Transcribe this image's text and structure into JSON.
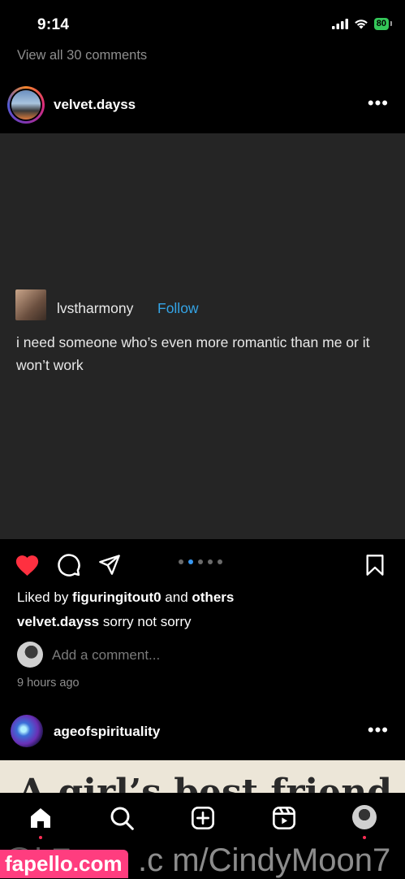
{
  "status_bar": {
    "time": "9:14",
    "battery": "80"
  },
  "previous_post": {
    "view_comments": "View all 30 comments"
  },
  "post1": {
    "username": "velvet.dayss",
    "quote": {
      "username": "lvstharmony",
      "follow": "Follow",
      "text": "i need someone who’s even more romantic than me or it won’t work"
    },
    "liked_by_prefix": "Liked by ",
    "liked_by_user": "figuringitout0",
    "liked_by_and": " and ",
    "liked_by_others": "others",
    "caption_user": "velvet.dayss",
    "caption_text": " sorry not sorry",
    "add_comment_placeholder": "Add a comment...",
    "time_ago": "9 hours ago"
  },
  "post2": {
    "username": "ageofspirituality",
    "image_text": "A girl’s best friend isn’t"
  },
  "watermark": {
    "site": "fapello.com",
    "text": ".c m/CindyMoon7",
    "left_text": "@i F"
  },
  "colors": {
    "accent_blue": "#3897f0",
    "like_red": "#ff3040",
    "follow_blue": "#34a4e6"
  },
  "icons": [
    "heart-icon",
    "comment-icon",
    "share-icon",
    "bookmark-icon",
    "home-icon",
    "search-icon",
    "create-icon",
    "reels-icon",
    "more-icon"
  ]
}
